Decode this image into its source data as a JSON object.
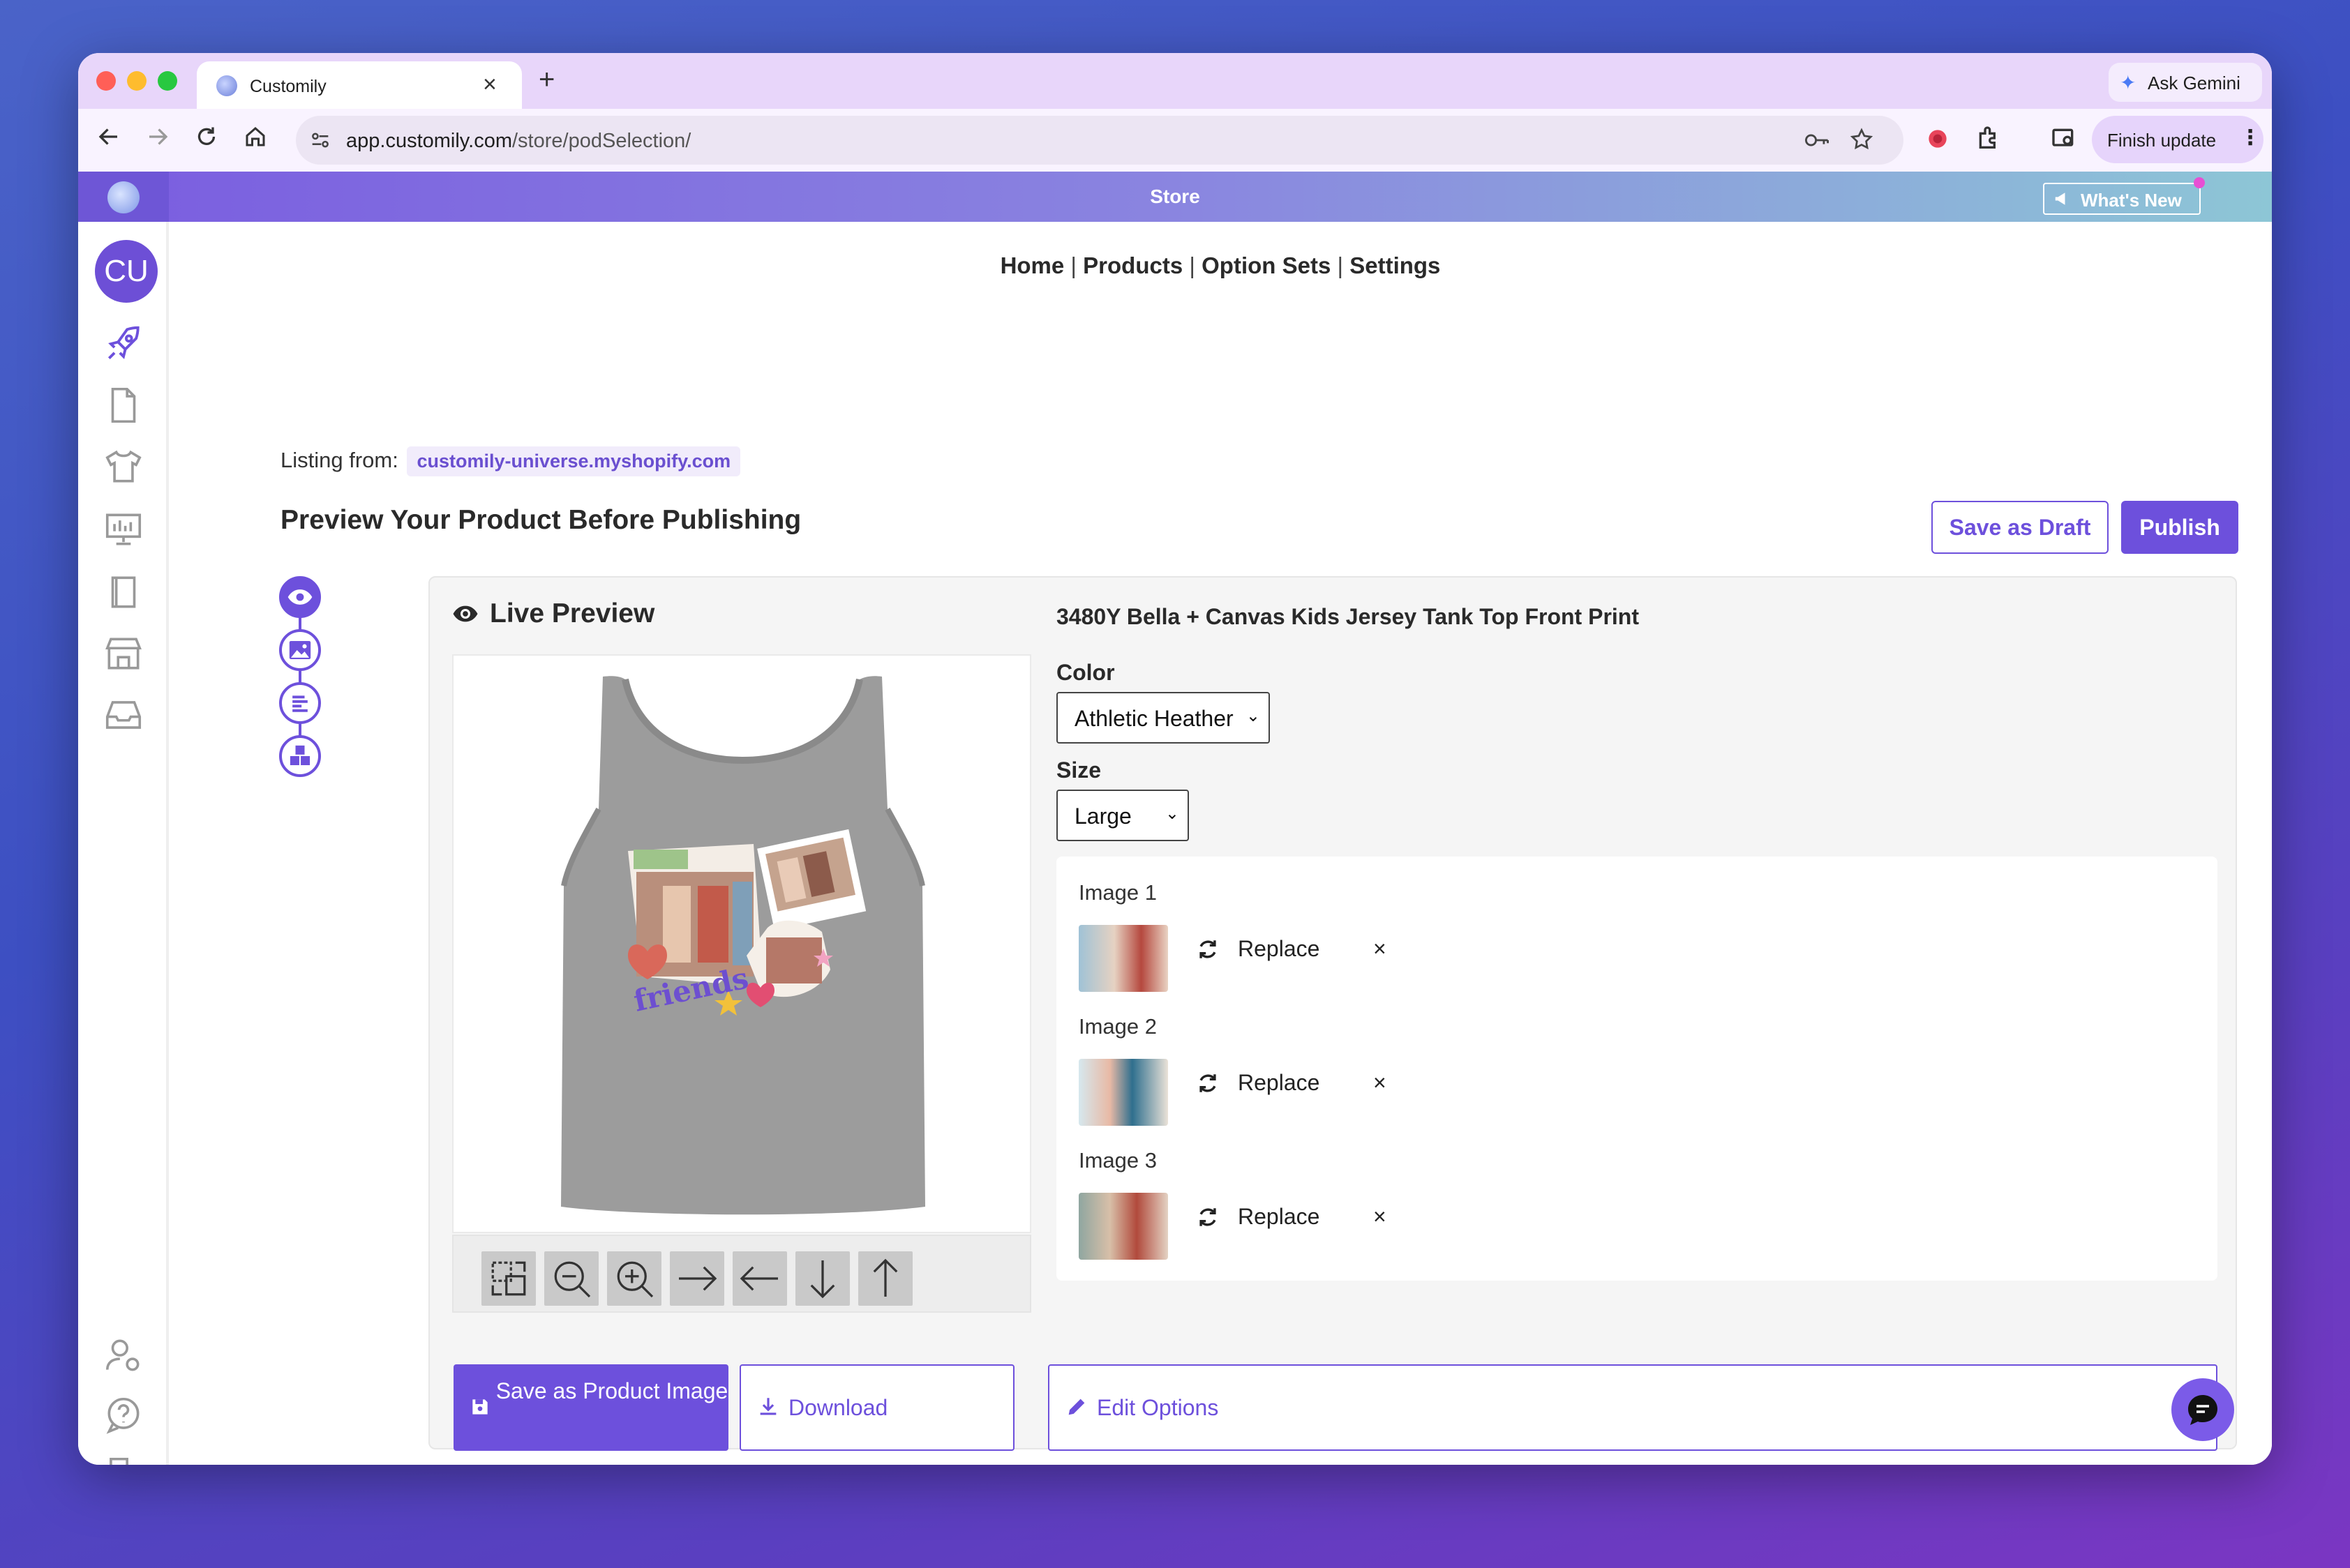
{
  "browser": {
    "tab_title": "Customily",
    "tab_close": "×",
    "new_tab": "+",
    "ask_gemini": "Ask Gemini",
    "url_domain": "app.customily.com",
    "url_path": "/store/podSelection/",
    "finish_update": "Finish update"
  },
  "appbar": {
    "title": "Store",
    "whats_new": "What's New"
  },
  "sidebar": {
    "avatar_initials": "CU",
    "items": [
      "rocket-icon",
      "document-icon",
      "tshirt-icon",
      "dashboard-icon",
      "book-icon",
      "store-icon",
      "inbox-icon"
    ],
    "bottom_items": [
      "user-settings-icon",
      "help-icon",
      "logout-icon"
    ]
  },
  "topnav": {
    "items": [
      "Home",
      "Products",
      "Option Sets",
      "Settings"
    ],
    "separator": "|"
  },
  "listing": {
    "label": "Listing from:",
    "store": "customily-universe.myshopify.com"
  },
  "page": {
    "title": "Preview Your Product Before Publishing",
    "save_draft": "Save as Draft",
    "publish": "Publish"
  },
  "preview": {
    "title": "Live Preview",
    "product_title": "3480Y Bella + Canvas Kids Jersey Tank Top Front Print",
    "color_label": "Color",
    "color_value": "Athletic Heather",
    "size_label": "Size",
    "size_value": "Large",
    "images": [
      {
        "label": "Image 1",
        "replace": "Replace",
        "remove": "×"
      },
      {
        "label": "Image 2",
        "replace": "Replace",
        "remove": "×"
      },
      {
        "label": "Image 3",
        "replace": "Replace",
        "remove": "×"
      }
    ],
    "tools": [
      "fit-icon",
      "zoom-out-icon",
      "zoom-in-icon",
      "arrow-right-icon",
      "arrow-left-icon",
      "arrow-down-icon",
      "arrow-up-icon"
    ],
    "save_product_image": "Save as Product Image",
    "download": "Download",
    "edit_options": "Edit Options",
    "design_text": "friends"
  },
  "colors": {
    "accent": "#6d50dc",
    "shirt": "#9b9b9b"
  }
}
